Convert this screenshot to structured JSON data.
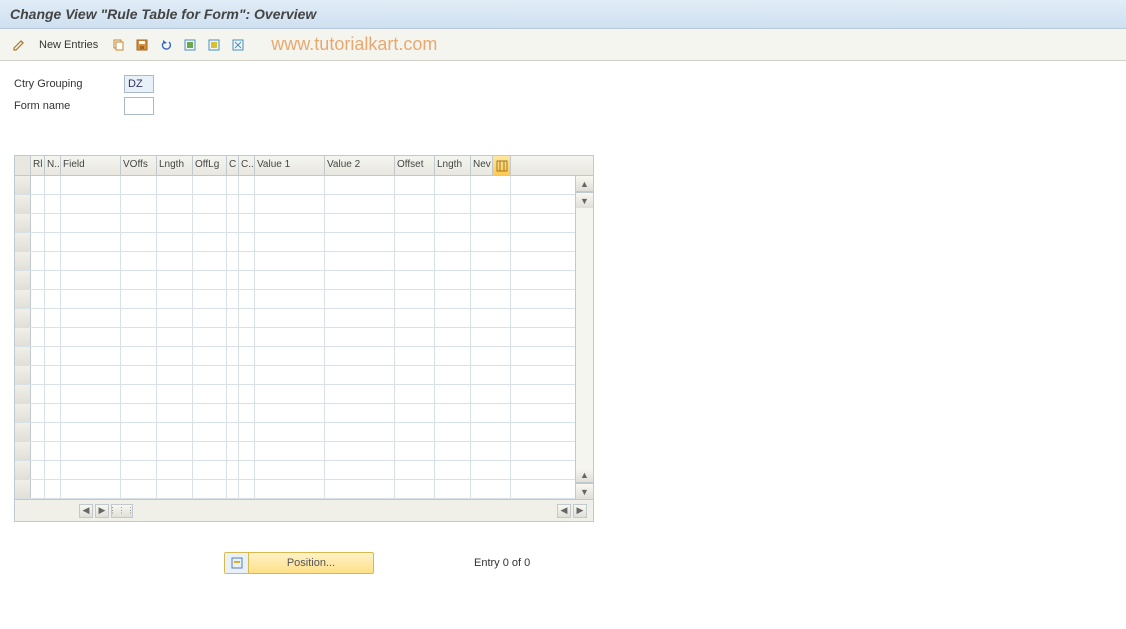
{
  "title": "Change View \"Rule Table for Form\": Overview",
  "toolbar": {
    "new_entries_label": "New Entries"
  },
  "watermark": "www.tutorialkart.com",
  "fields": {
    "ctry_grouping": {
      "label": "Ctry Grouping",
      "value": "DZ"
    },
    "form_name": {
      "label": "Form name",
      "value": ""
    }
  },
  "grid": {
    "columns": [
      "Rl",
      "N..",
      "Field",
      "VOffs",
      "Lngth",
      "OffLg",
      "C",
      "C..",
      "Value 1",
      "Value 2",
      "Offset",
      "Lngth",
      "Nev"
    ],
    "rows": []
  },
  "footer": {
    "position_label": "Position...",
    "entry_text": "Entry 0 of 0"
  }
}
